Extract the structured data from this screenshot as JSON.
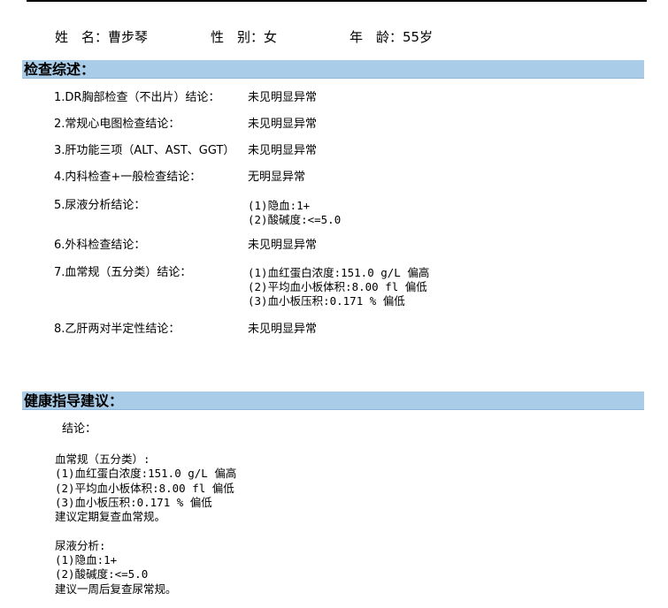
{
  "patient": {
    "name_label": "姓　名：",
    "name": "曹步琴",
    "gender_label": "性　别：",
    "gender": "女",
    "age_label": "年　龄：",
    "age": "55岁"
  },
  "summary": {
    "title": "检查综述：",
    "items": [
      {
        "label": "1.DR胸部检查（不出片）结论：",
        "values": [
          "未见明显异常"
        ]
      },
      {
        "label": "2.常规心电图检查结论：",
        "values": [
          "未见明显异常"
        ]
      },
      {
        "label": "3.肝功能三项（ALT、AST、GGT）",
        "values": [
          "未见明显异常"
        ]
      },
      {
        "label": "4.内科检查+一般检查结论：",
        "values": [
          "无明显异常"
        ]
      },
      {
        "label": "5.尿液分析结论：",
        "values": [
          "(1)隐血:1+",
          "(2)酸碱度:<=5.0"
        ]
      },
      {
        "label": "6.外科检查结论：",
        "values": [
          "未见明显异常"
        ]
      },
      {
        "label": "7.血常规（五分类）结论：",
        "values": [
          "(1)血红蛋白浓度:151.0 g/L 偏高",
          "(2)平均血小板体积:8.00 fl 偏低",
          "(3)血小板压积:0.171 % 偏低"
        ]
      },
      {
        "label": "8.乙肝两对半定性结论：",
        "values": [
          "未见明显异常"
        ]
      }
    ]
  },
  "advice": {
    "title": "健康指导建议：",
    "conclusion_label": "结论：",
    "lines": [
      "血常规（五分类）:",
      "(1)血红蛋白浓度:151.0 g/L 偏高",
      "(2)平均血小板体积:8.00 fl 偏低",
      "(3)血小板压积:0.171 % 偏低",
      "建议定期复查血常规。",
      "",
      "尿液分析:",
      "(1)隐血:1+",
      "(2)酸碱度:<=5.0",
      "建议一周后复查尿常规。"
    ]
  }
}
